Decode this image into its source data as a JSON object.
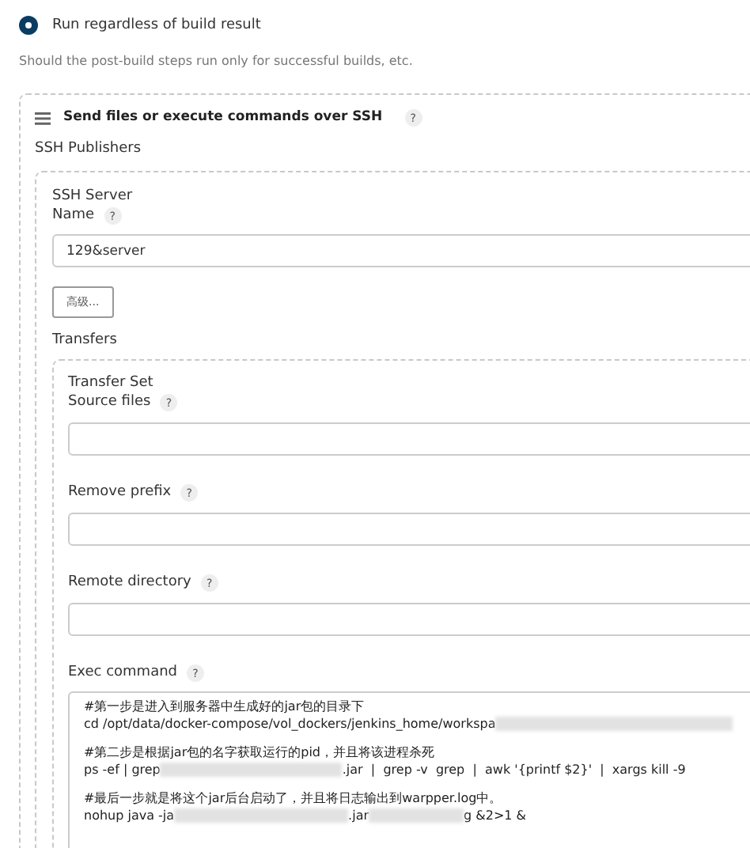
{
  "run_option": {
    "label": "Run regardless of build result",
    "selected": true
  },
  "run_hint": "Should the post-build steps run only for successful builds, etc.",
  "publisher": {
    "title": "Send files or execute commands over SSH",
    "help": "?",
    "section_label": "SSH Publishers",
    "server": {
      "heading": "SSH Server",
      "name_label": "Name",
      "name_help": "?",
      "name_value": "129&server",
      "advanced_button": "高级...",
      "transfers_label": "Transfers",
      "transfer_set": {
        "heading": "Transfer Set",
        "fields": [
          {
            "label": "Source files",
            "help": "?"
          },
          {
            "label": "Remove prefix",
            "help": "?"
          },
          {
            "label": "Remote directory",
            "help": "?"
          }
        ],
        "exec_label": "Exec command",
        "exec_help": "?",
        "exec_blocks": [
          [
            [
              {
                "kind": "text",
                "text": "#第一步是进入到服务器中生成好的jar包的目录下"
              }
            ],
            [
              {
                "kind": "text",
                "text": "cd /opt/data/docker-compose/vol_dockers/jenkins_home/workspa"
              },
              {
                "kind": "blur"
              }
            ]
          ],
          [
            [
              {
                "kind": "text",
                "text": "#第二步是根据jar包的名字获取运行的pid，并且将该进程杀死"
              }
            ],
            [
              {
                "kind": "text",
                "text": "ps -ef | grep"
              },
              {
                "kind": "blur"
              },
              {
                "kind": "text",
                "text": ".jar  |  grep -v  grep  |  awk '{printf $2}'  |  xargs kill -9"
              }
            ]
          ],
          [
            [
              {
                "kind": "text",
                "text": "#最后一步就是将这个jar后台启动了，并且将日志输出到warpper.log中。"
              }
            ],
            [
              {
                "kind": "text",
                "text": "nohup java -ja"
              },
              {
                "kind": "blur"
              },
              {
                "kind": "text",
                "text": ".jar"
              },
              {
                "kind": "blur"
              },
              {
                "kind": "text",
                "text": "g &2>1 &"
              }
            ]
          ]
        ]
      }
    }
  }
}
